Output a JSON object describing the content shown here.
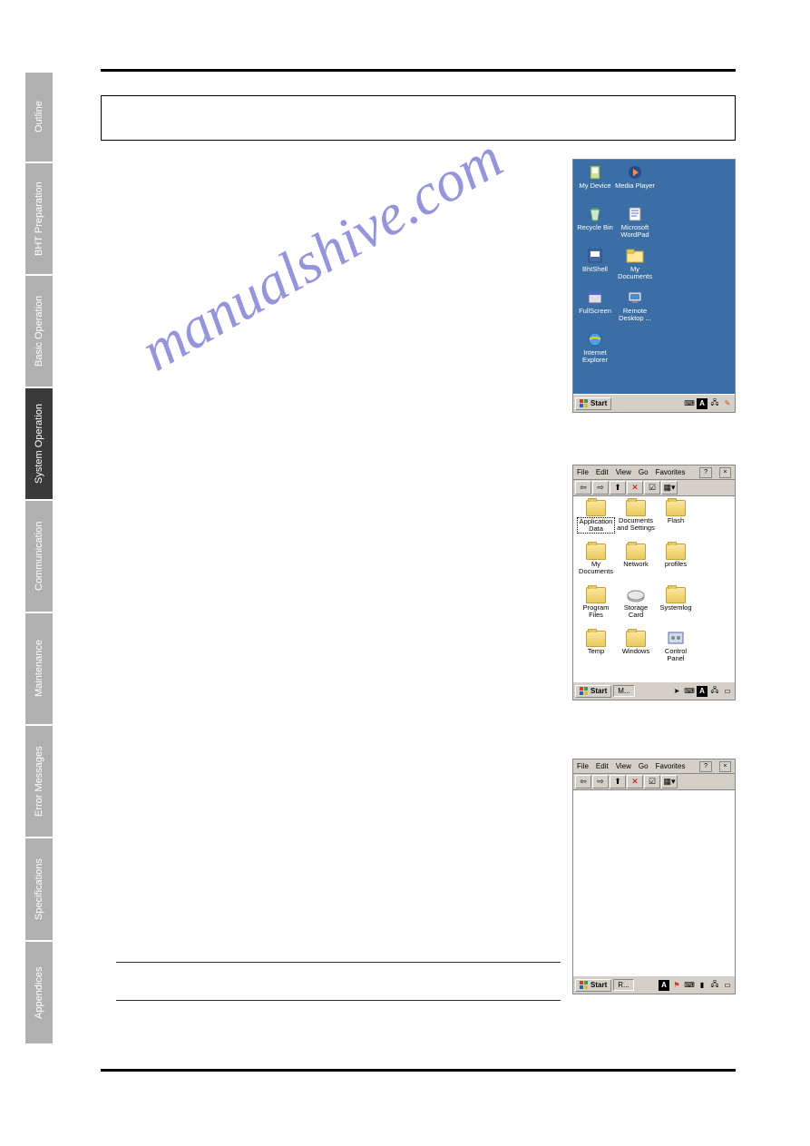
{
  "sidebar": {
    "tabs": [
      {
        "label": "Outline",
        "active": false
      },
      {
        "label": "BHT Preparation",
        "active": false
      },
      {
        "label": "Basic Operation",
        "active": false
      },
      {
        "label": "System Operation",
        "active": true
      },
      {
        "label": "Communication",
        "active": false
      },
      {
        "label": "Maintenance",
        "active": false
      },
      {
        "label": "Error Messages",
        "active": false
      },
      {
        "label": "Specifications",
        "active": false
      },
      {
        "label": "Appendices",
        "active": false
      }
    ]
  },
  "watermark": "manualshive.com",
  "desktop": {
    "icons": [
      {
        "name": "my-device",
        "label": "My Device"
      },
      {
        "name": "recycle-bin",
        "label": "Recycle Bin"
      },
      {
        "name": "bhtshell",
        "label": "BhtShell"
      },
      {
        "name": "fullscreen",
        "label": "FullScreen"
      },
      {
        "name": "internet-explorer",
        "label": "Internet Explorer"
      },
      {
        "name": "media-player",
        "label": "Media Player"
      },
      {
        "name": "microsoft-wordpad",
        "label": "Microsoft WordPad"
      },
      {
        "name": "my-documents",
        "label": "My Documents"
      },
      {
        "name": "remote-desktop",
        "label": "Remote Desktop ..."
      }
    ],
    "start": "Start",
    "tray_indicator": "A"
  },
  "explorer1": {
    "menu": [
      "File",
      "Edit",
      "View",
      "Go",
      "Favorites"
    ],
    "help": "?",
    "close": "×",
    "folders": [
      {
        "label": "Application Data",
        "selected": true,
        "type": "folder"
      },
      {
        "label": "Documents and Settings",
        "type": "folder"
      },
      {
        "label": "Flash",
        "type": "folder"
      },
      {
        "label": "My Documents",
        "type": "folder"
      },
      {
        "label": "Network",
        "type": "folder"
      },
      {
        "label": "profiles",
        "type": "folder"
      },
      {
        "label": "Program Files",
        "type": "folder"
      },
      {
        "label": "Storage Card",
        "type": "drive"
      },
      {
        "label": "Systemlog",
        "type": "folder"
      },
      {
        "label": "Temp",
        "type": "folder"
      },
      {
        "label": "Windows",
        "type": "folder"
      },
      {
        "label": "Control Panel",
        "type": "control"
      }
    ],
    "start": "Start",
    "task": "M...",
    "tray_indicator": "A"
  },
  "explorer2": {
    "menu": [
      "File",
      "Edit",
      "View",
      "Go",
      "Favorites"
    ],
    "help": "?",
    "close": "×",
    "start": "Start",
    "task": "R...",
    "tray_indicator": "A"
  }
}
